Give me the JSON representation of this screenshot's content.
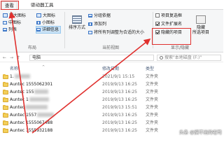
{
  "tabs": [
    "查看",
    "驱动器工具"
  ],
  "ribbon": {
    "layout": {
      "large_icons": "超大图标",
      "big_icons": "大图标",
      "medium_icons": "中图标",
      "small_icons": "小图标",
      "list": "列表",
      "details": "详细信息",
      "group": "布局"
    },
    "current_view": {
      "sort_by": "排序方式",
      "group_by": "分组依据",
      "add_columns": "添加列",
      "fit_columns": "将所有列调整为合适的大小",
      "group": "当前视图"
    },
    "show_hide": {
      "item_checkboxes": "项目复选框",
      "item_checkboxes_checked": false,
      "file_extensions": "文件扩展名",
      "file_extensions_checked": true,
      "hidden_items": "隐藏的项目",
      "hidden_items_checked": true,
      "hide_selected": "隐藏",
      "hide_selected_sub": "所选项目",
      "group": "显示/隐藏"
    }
  },
  "address": {
    "breadcrumb": "电脑",
    "search_placeholder": "搜索\"本地磁盘 (F:)\""
  },
  "columns": {
    "name": "名称",
    "date": "修改日期",
    "type": "类型"
  },
  "files": [
    {
      "name": "1.",
      "date": "2021/9/1 15:15",
      "type": "文件夹"
    },
    {
      "name": "Auntec 1555062301",
      "date": "2019/9/13 16:25",
      "type": "文件夹"
    },
    {
      "name": "Auntec 155",
      "date": "2019/9/13 16:25",
      "type": "文件夹"
    },
    {
      "name": "Auntec 1",
      "date": "2019/9/13 16:25",
      "type": "文件夹"
    },
    {
      "name": "Auntec",
      "date": "2019/9/13 15:51",
      "type": "文件夹"
    },
    {
      "name": "Auntec 1557",
      "date": "2019/9/13 16:25",
      "type": "文件夹"
    },
    {
      "name": "Auntec 1555067488",
      "date": "2019/9/13 16:25",
      "type": "文件夹"
    },
    {
      "name": "Auntec 1555932188",
      "date": "2019/9/13 16:25",
      "type": "文件夹"
    }
  ],
  "watermark": "头条 @搞不出的老司",
  "colors": {
    "accent_red": "#e0302e",
    "selection": "#cce4f7",
    "folder": "#f3cf5a"
  }
}
